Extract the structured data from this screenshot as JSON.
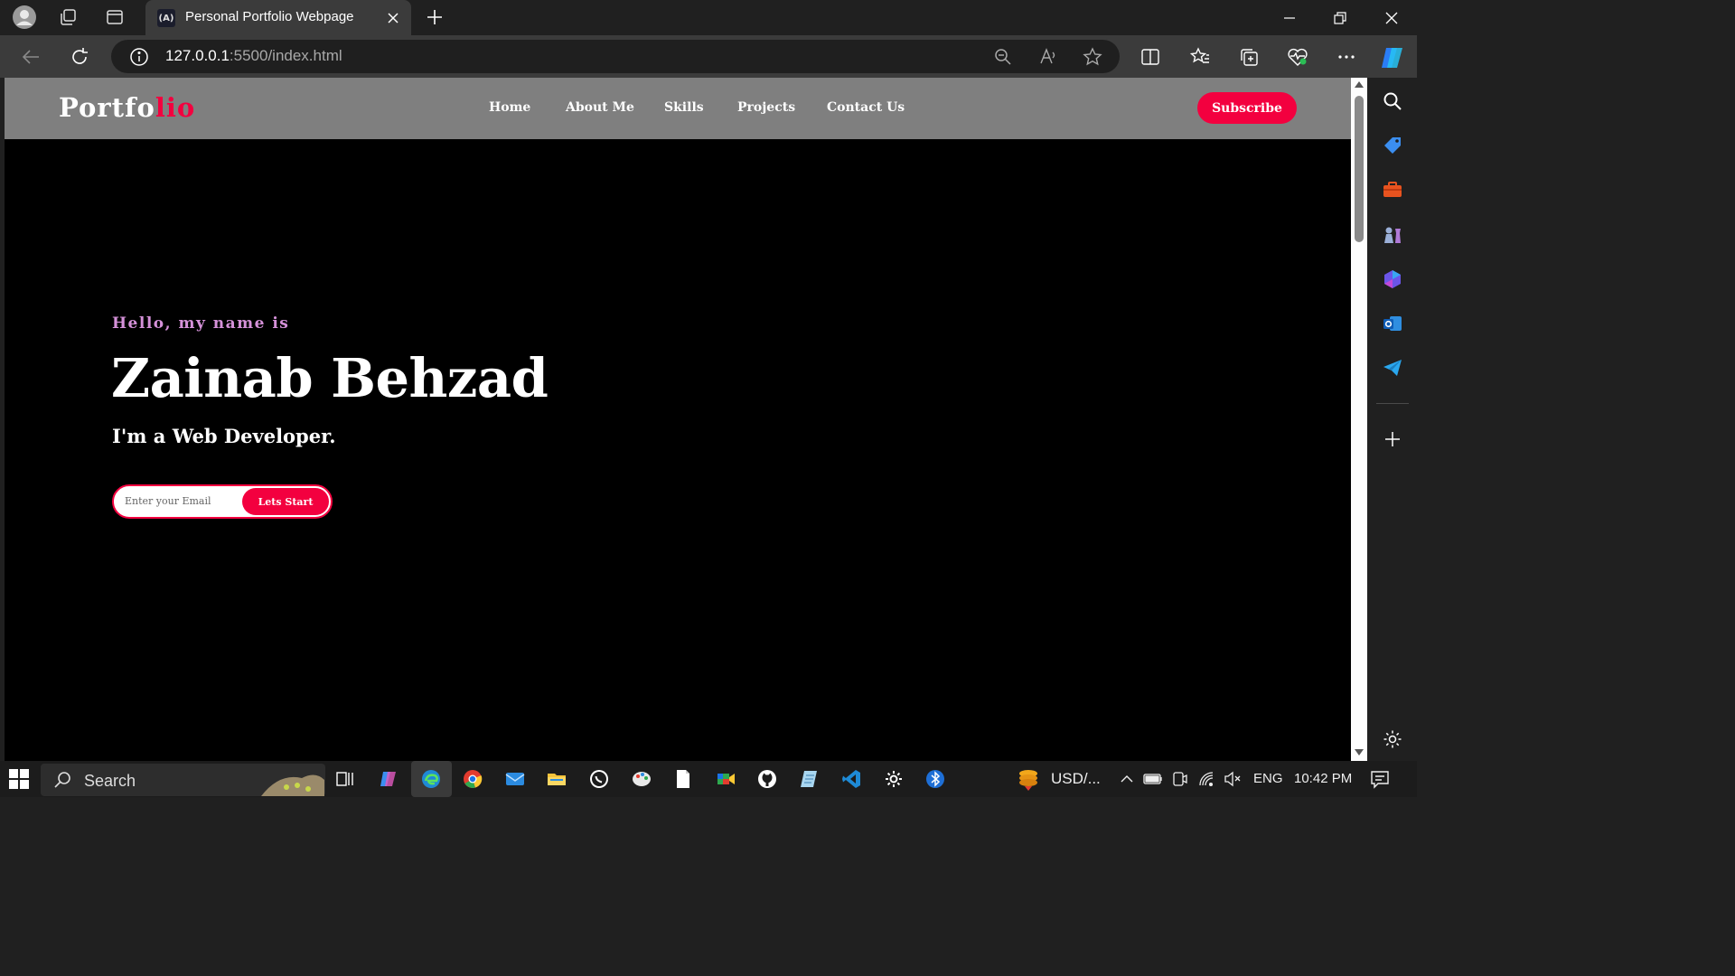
{
  "browser": {
    "tab_title": "Personal Portfolio Webpage",
    "tab_favicon_text": "(A)",
    "address_host": "127.0.0.1",
    "address_rest": ":5500/index.html"
  },
  "site": {
    "logo_main": "Portfo",
    "logo_accent": "lio",
    "nav": [
      "Home",
      "About Me",
      "Skills",
      "Projects",
      "Contact Us"
    ],
    "subscribe_label": "Subscribe",
    "hero": {
      "greeting": "Hello, my name is",
      "name": "Zainab Behzad",
      "role": "I'm a Web Developer.",
      "email_placeholder": "Enter your Email",
      "cta_label": "Lets Start"
    }
  },
  "taskbar": {
    "search_label": "Search",
    "currency": "USD/...",
    "language": "ENG",
    "time": "10:42 PM"
  },
  "colors": {
    "accent": "#f3003f",
    "greeting": "#d591d9",
    "nav_bg": "#7f7f7f",
    "hero_bg": "#000000"
  }
}
